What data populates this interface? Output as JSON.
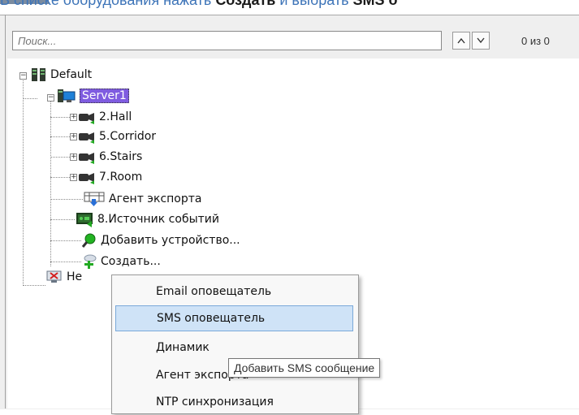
{
  "instruction": {
    "prefix": "В списке оборудования нажать ",
    "bold1": "Создать",
    "middle": " и выбрать ",
    "bold2": "SMS о"
  },
  "search": {
    "placeholder": "Поиск...",
    "counter": "0 из 0"
  },
  "tree": {
    "root": "Default",
    "server": "Server1",
    "items": [
      {
        "label": "2.Hall",
        "icon": "camera-icon"
      },
      {
        "label": "5.Corridor",
        "icon": "camera-icon"
      },
      {
        "label": "6.Stairs",
        "icon": "camera-icon"
      },
      {
        "label": "7.Room",
        "icon": "camera-icon"
      },
      {
        "label": "Агент экспорта",
        "icon": "export-agent-icon"
      },
      {
        "label": "8.Источник событий",
        "icon": "event-source-icon"
      },
      {
        "label": "Добавить устройство...",
        "icon": "add-device-search-icon"
      },
      {
        "label": "Создать...",
        "icon": "create-icon"
      }
    ],
    "unassigned_partial": "Не"
  },
  "context_menu": {
    "items": [
      {
        "label": "Email оповещатель"
      },
      {
        "label": "SMS оповещатель",
        "highlighted": true
      },
      {
        "label": "Динамик"
      },
      {
        "label": "Агент экспорта"
      },
      {
        "label": "NTP синхронизация"
      }
    ]
  },
  "tooltip": {
    "text": "Добавить SMS сообщение"
  },
  "colors": {
    "selection": "#7f5ce0",
    "menu_highlight": "#cfe3f7",
    "instruction_link": "#3d74b8"
  }
}
